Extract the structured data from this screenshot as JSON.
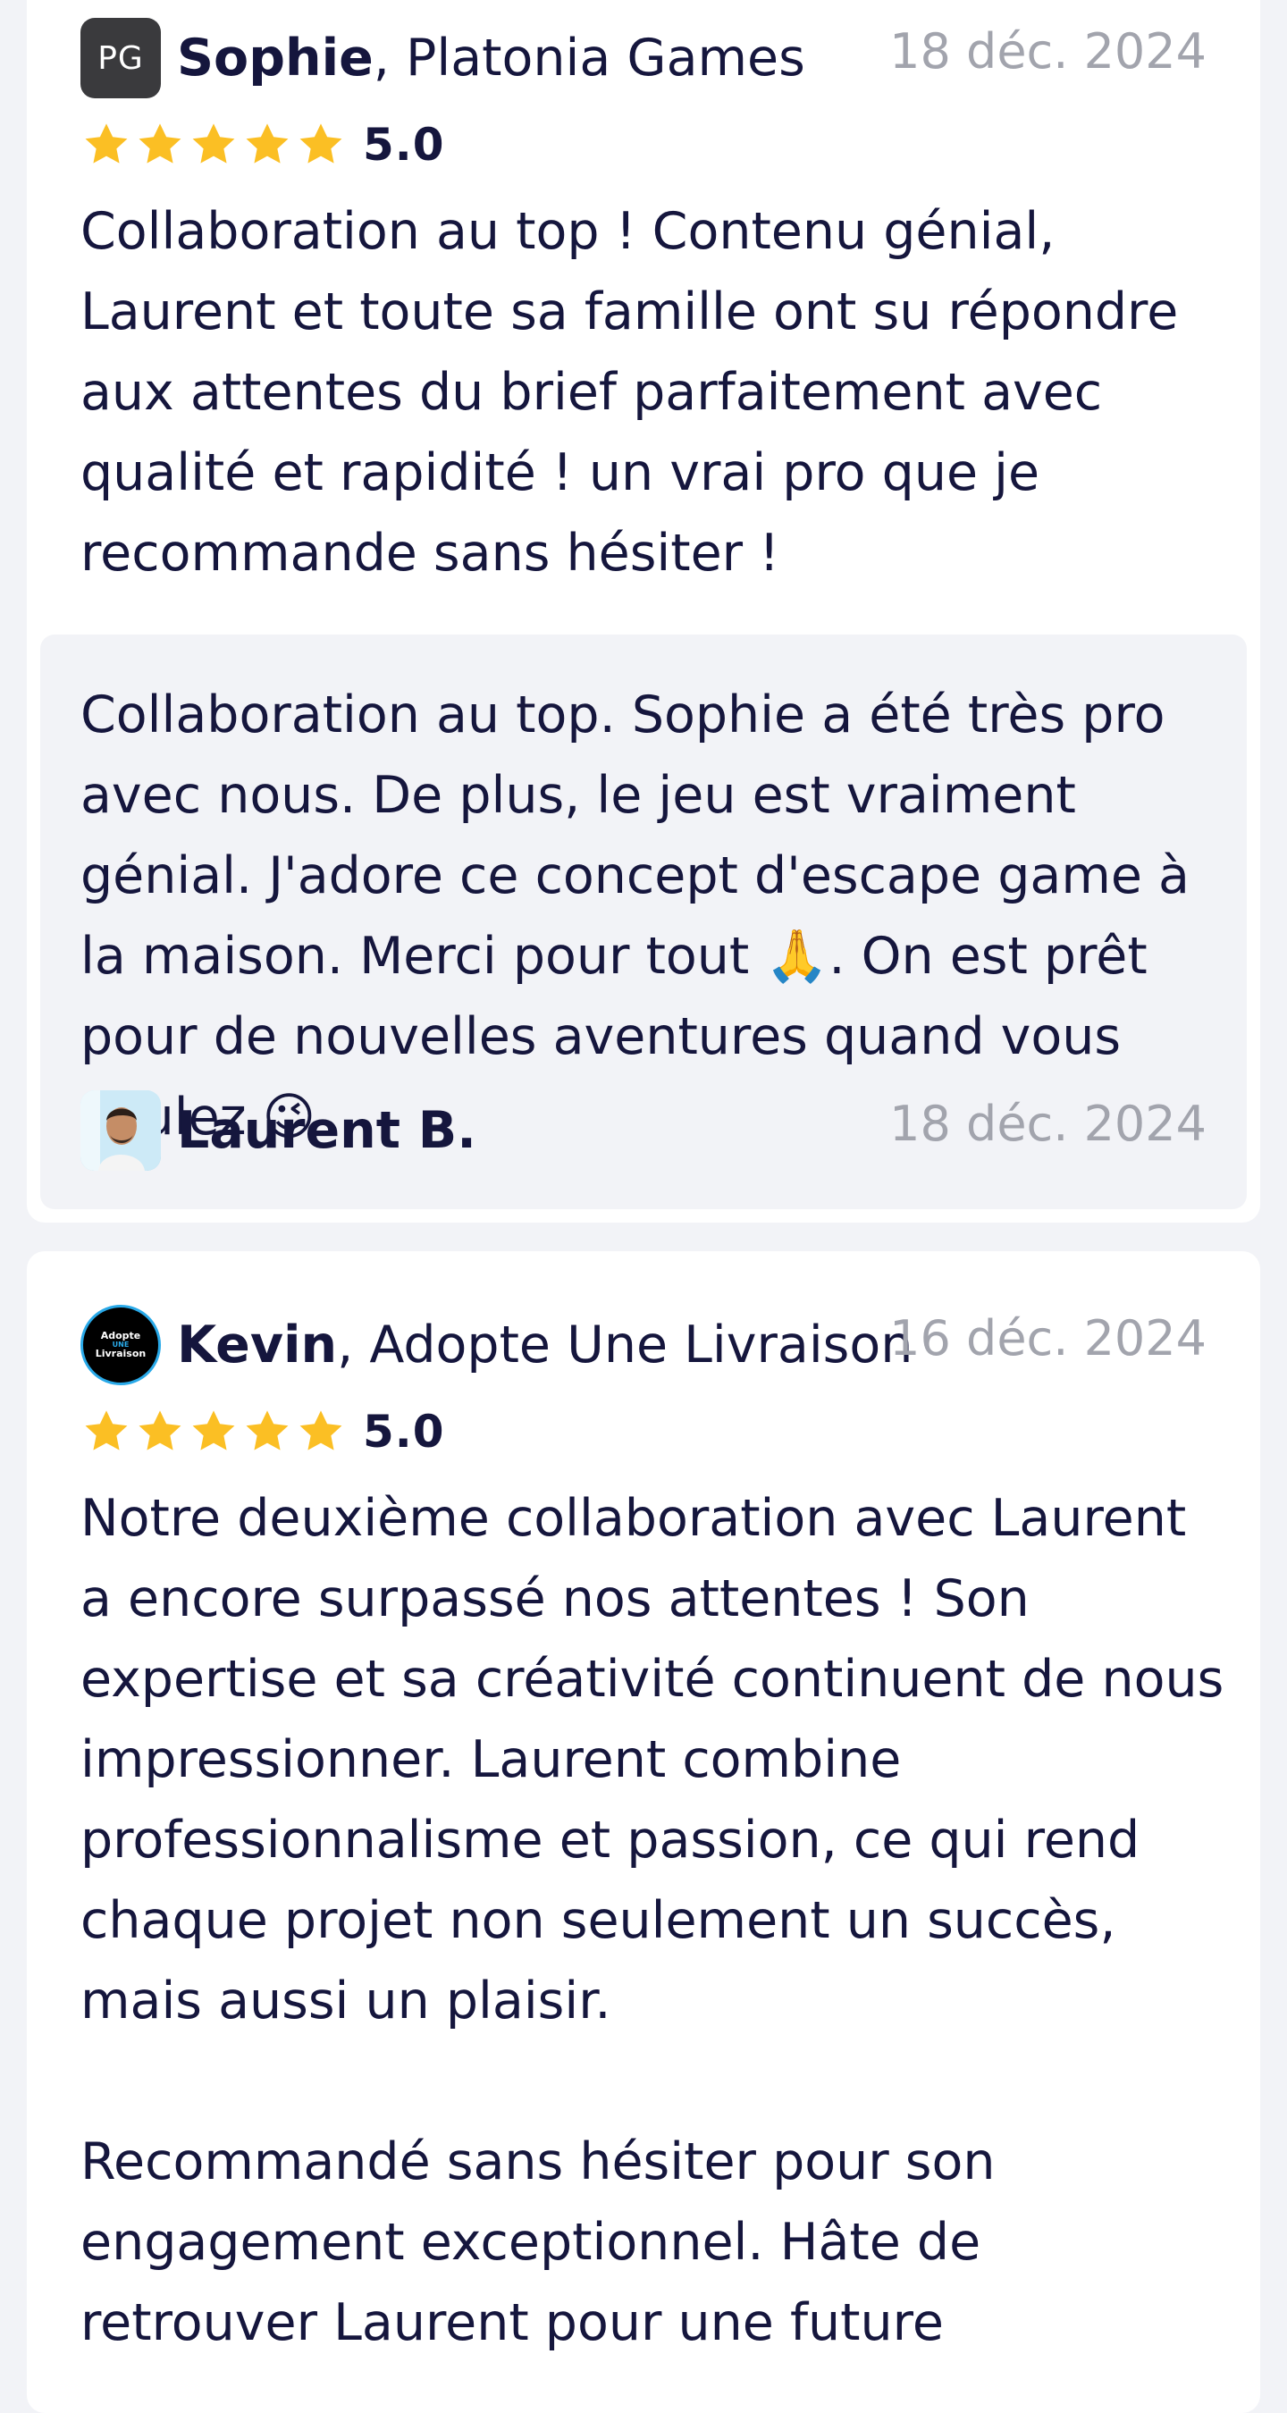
{
  "reviews": [
    {
      "avatar_text": "PG",
      "name": "Sophie",
      "company": ", Platonia Games",
      "date": "18 déc. 2024",
      "rating": "5.0",
      "text": "Collaboration au top ! Contenu génial, Laurent et toute sa famille ont su répondre aux attentes du brief parfaitement avec qualité et rapidité ! un vrai pro que je recommande sans hésiter !",
      "reply": {
        "text": "Collaboration au top. Sophie a été très pro avec nous. De plus, le jeu est vraiment génial. J'adore ce concept d'escape game à la maison. Merci pour tout 🙏. On est prêt pour de nouvelles aventures quand vous voulez 😉",
        "name": "Laurent B.",
        "date": "18 déc. 2024"
      }
    },
    {
      "avatar_lines": [
        "Adopte",
        "UNE",
        "Livraison"
      ],
      "name": "Kevin",
      "company": ", Adopte Une Livraison",
      "date": "16 déc. 2024",
      "rating": "5.0",
      "text": "Notre deuxième collaboration avec Laurent a encore surpassé nos attentes ! Son expertise et sa créativité continuent de nous impressionner. Laurent combine professionnalisme et passion, ce qui rend chaque projet non seulement un succès, mais aussi un plaisir.\n\nRecommandé sans hésiter pour son engagement exceptionnel. Hâte de retrouver Laurent pour une future"
    }
  ],
  "colors": {
    "star": "#fbbf24",
    "text": "#15163d",
    "muted": "#a2a4ad",
    "background": "#f2f3f7"
  },
  "icons": {
    "star": "star-icon"
  }
}
